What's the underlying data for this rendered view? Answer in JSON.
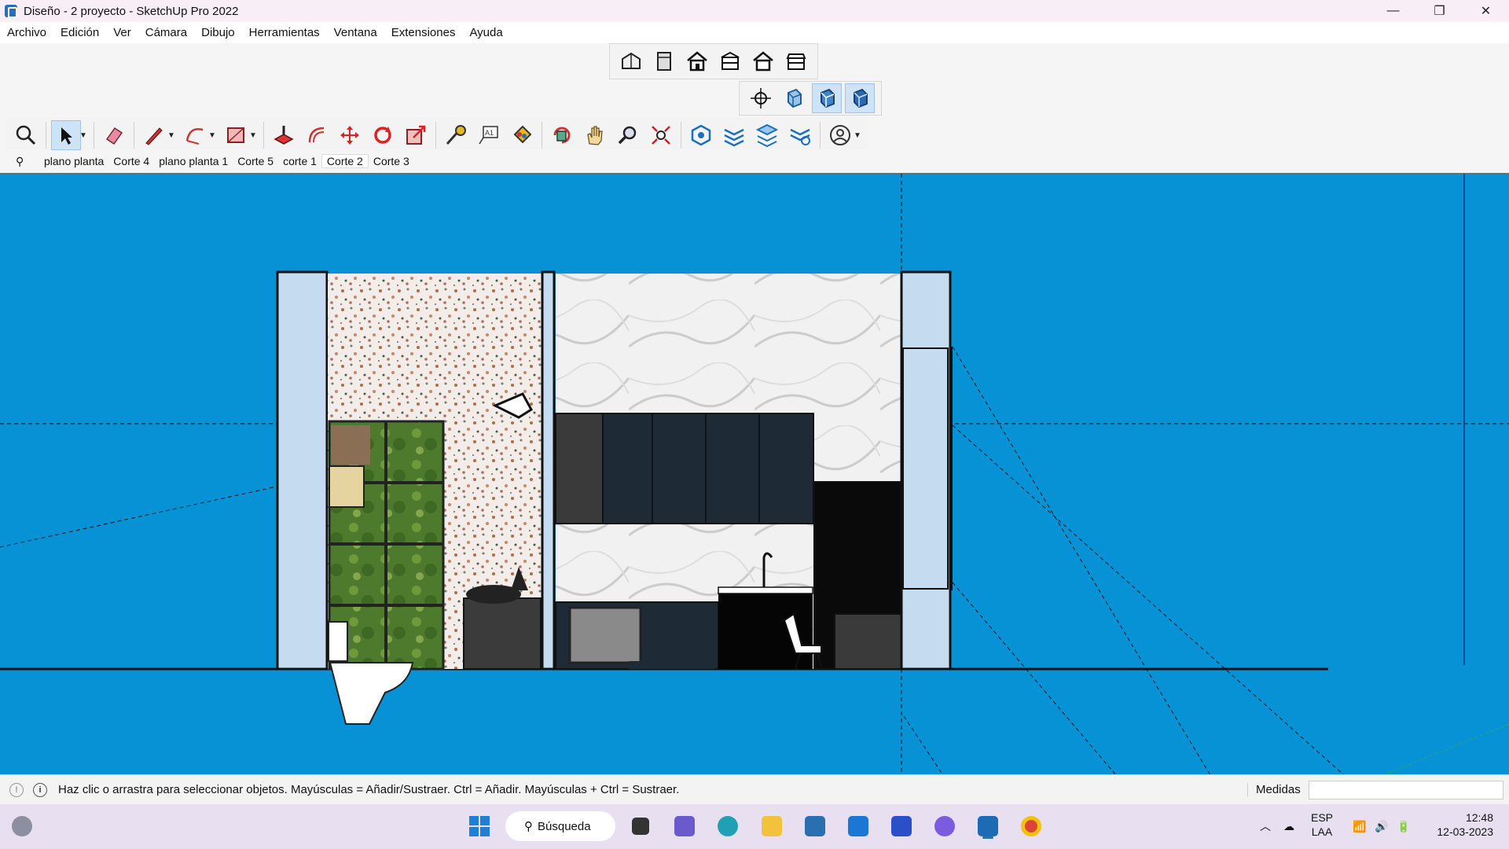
{
  "window": {
    "title": "Diseño - 2 proyecto - SketchUp Pro 2022",
    "minimize": "—",
    "restore": "❐",
    "close": "✕"
  },
  "menu": [
    "Archivo",
    "Edición",
    "Ver",
    "Cámara",
    "Dibujo",
    "Herramientas",
    "Ventana",
    "Extensiones",
    "Ayuda"
  ],
  "toolbars": {
    "views": [
      "iso-view-icon",
      "top-view-icon",
      "front-view-icon",
      "right-view-icon",
      "back-view-icon",
      "left-view-icon"
    ],
    "camera": [
      "orbit-icon",
      "xray-icon",
      "shaded-icon",
      "textured-icon"
    ],
    "main": [
      "zoom-extents-icon",
      "select-icon",
      "eraser-icon",
      "pencil-icon",
      "arc-icon",
      "rectangle-icon",
      "push-pull-icon",
      "offset-icon",
      "move-icon",
      "rotate-icon",
      "scale-icon",
      "tape-measure-icon",
      "text-icon",
      "paint-bucket-icon",
      "orbit-tool-icon",
      "pan-icon",
      "zoom-icon",
      "zoom-window-icon",
      "section-plane-icon",
      "display-sections-icon",
      "section-cuts-icon",
      "section-fill-icon",
      "account-icon"
    ]
  },
  "scenes": {
    "tabs": [
      "plano planta",
      "Corte 4",
      "plano planta 1",
      "Corte 5",
      "corte 1",
      "Corte 2",
      "Corte 3"
    ],
    "active": "Corte 2"
  },
  "status": {
    "message": "Haz clic o arrastra para seleccionar objetos. Mayúsculas = Añadir/Sustraer. Ctrl = Añadir. Mayúsculas + Ctrl = Sustraer.",
    "measure_label": "Medidas",
    "measure_value": ""
  },
  "taskbar": {
    "search_label": "Búsqueda",
    "lang": "ESP",
    "layout": "LAA",
    "time": "12:48",
    "date": "12-03-2023"
  },
  "colors": {
    "viewport_bg": "#0892d6",
    "accent": "#2a6fb0"
  }
}
